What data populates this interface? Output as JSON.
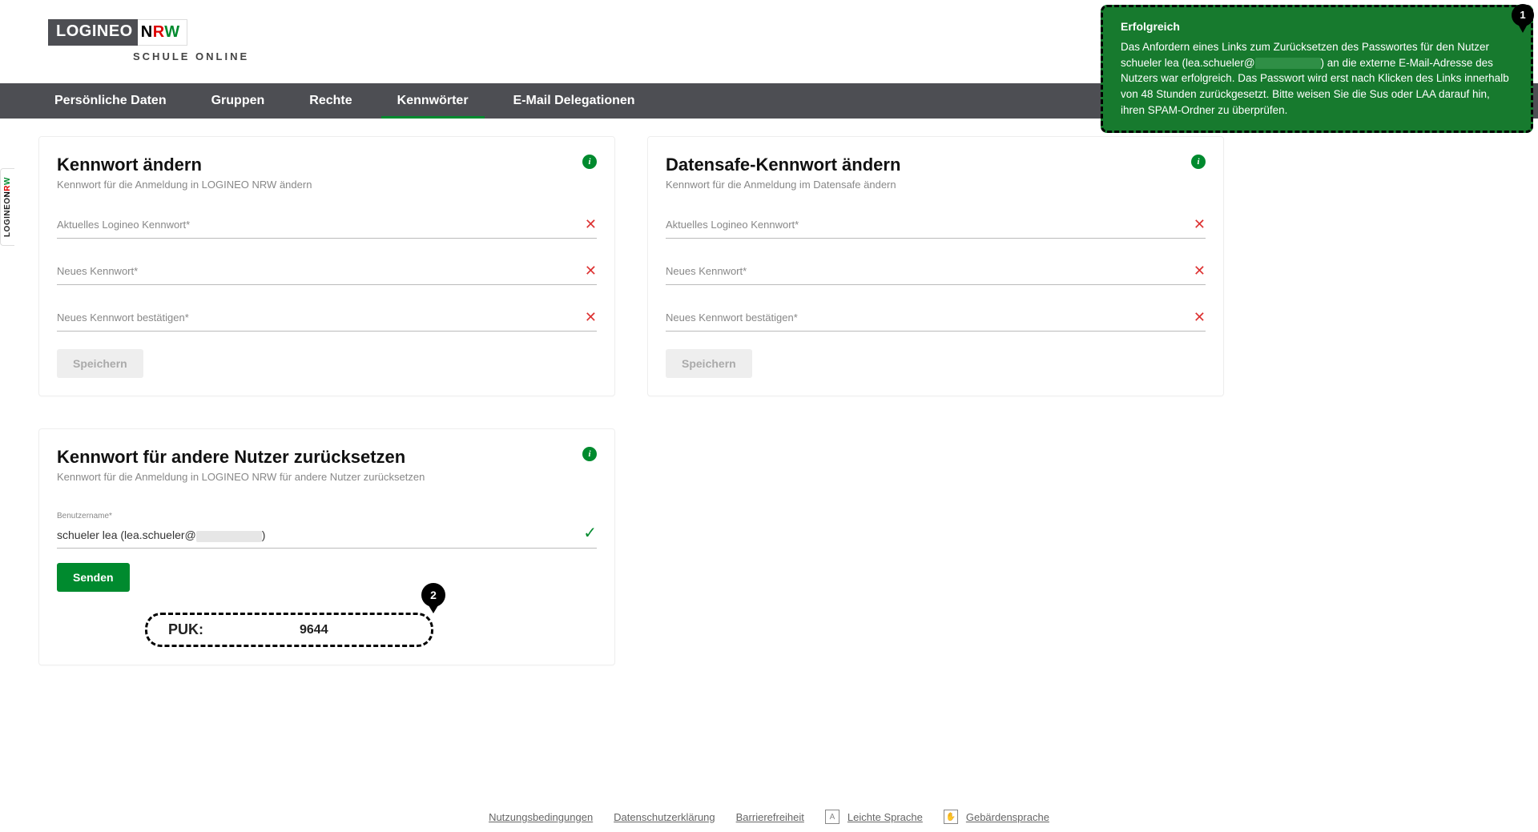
{
  "logo": {
    "part1": "LOGINEO",
    "nrw_n": "N",
    "nrw_r": "R",
    "nrw_w": "W",
    "sub": "SCHULE ONLINE"
  },
  "nav": {
    "items": [
      {
        "label": "Persönliche Daten"
      },
      {
        "label": "Gruppen"
      },
      {
        "label": "Rechte"
      },
      {
        "label": "Kennwörter",
        "active": true
      },
      {
        "label": "E-Mail Delegationen"
      }
    ]
  },
  "cards": {
    "pw": {
      "title": "Kennwort ändern",
      "sub": "Kennwort für die Anmeldung in LOGINEO NRW ändern",
      "fields": [
        "Aktuelles Logineo Kennwort*",
        "Neues Kennwort*",
        "Neues Kennwort bestätigen*"
      ],
      "save": "Speichern"
    },
    "safe": {
      "title": "Datensafe-Kennwort ändern",
      "sub": "Kennwort für die Anmeldung im Datensafe ändern",
      "fields": [
        "Aktuelles Logineo Kennwort*",
        "Neues Kennwort*",
        "Neues Kennwort bestätigen*"
      ],
      "save": "Speichern"
    },
    "reset": {
      "title": "Kennwort für andere Nutzer zurücksetzen",
      "sub": "Kennwort für die Anmeldung in LOGINEO NRW für andere Nutzer zurücksetzen",
      "user_label": "Benutzername*",
      "user_value_pre": "schueler lea (lea.schueler@",
      "user_value_post": ")",
      "send": "Senden",
      "puk_label": "PUK:",
      "puk_value": "9644",
      "puk_marker": "2"
    }
  },
  "toast": {
    "title": "Erfolgreich",
    "body_pre": "Das Anfordern eines Links zum Zurücksetzen des Passwortes für den Nutzer schueler lea (lea.schueler@",
    "body_post": ") an die externe E-Mail-Adresse des Nutzers war erfolgreich. Das Passwort wird erst nach Klicken des Links innerhalb von 48 Stunden zurückgesetzt. Bitte weisen Sie die Sus oder LAA darauf hin, ihren SPAM-Ordner zu überprüfen.",
    "marker": "1"
  },
  "footer": {
    "links": [
      "Nutzungsbedingungen",
      "Datenschutzerklärung",
      "Barrierefreiheit"
    ],
    "extra": [
      "Leichte Sprache",
      "Gebärdensprache"
    ]
  },
  "sidetab": {
    "part1": "LOGINEO",
    "nrw_n": "N",
    "nrw_r": "R",
    "nrw_w": "W"
  },
  "icons": {
    "info": "i",
    "x": "✕",
    "check": "✓"
  },
  "colors": {
    "green": "#008a2e",
    "toast_green": "#177a2e",
    "red": "#d33",
    "nav_bg": "#4d4e53"
  }
}
